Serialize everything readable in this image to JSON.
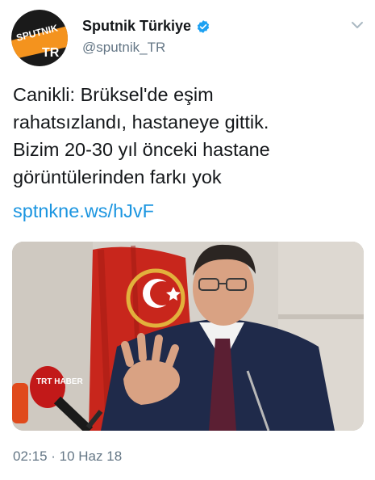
{
  "account": {
    "display_name": "Sputnik Türkiye",
    "handle": "@sputnik_TR",
    "verified": true,
    "avatar_logo_text": "SPUTNIK",
    "avatar_badge_text": "TR"
  },
  "tweet": {
    "text_lines": [
      "Canikli: Brüksel'de eşim",
      "rahatsızlandı, hastaneye gittik.",
      "Bizim 20-30 yıl önceki hastane",
      "görüntülerinden farkı yok"
    ],
    "link": "sptnkne.ws/hJvF",
    "timestamp": "02:15 · 10 Haz 18"
  },
  "media": {
    "microphone_logo_text": "TRT HABER"
  },
  "colors": {
    "link": "#1b95e0",
    "secondary_text": "#657786",
    "verified": "#1da1f2",
    "brand_orange": "#f4931e"
  },
  "icons": {
    "verified": "verified-badge-icon",
    "more": "chevron-down-icon"
  }
}
